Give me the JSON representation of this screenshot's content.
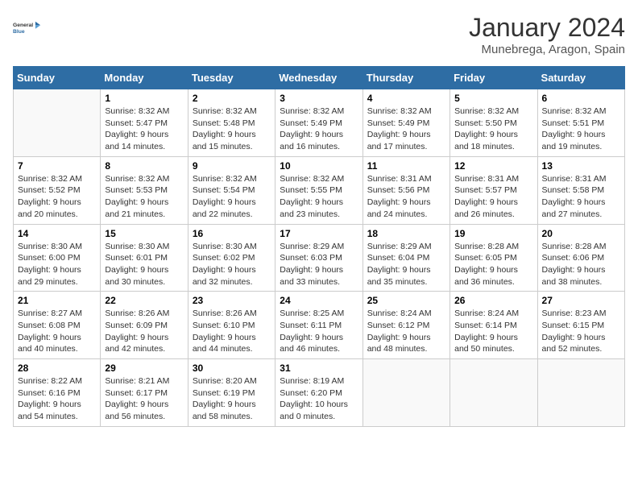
{
  "header": {
    "logo_line1": "General",
    "logo_line2": "Blue",
    "month_title": "January 2024",
    "location": "Munebrega, Aragon, Spain"
  },
  "days_of_week": [
    "Sunday",
    "Monday",
    "Tuesday",
    "Wednesday",
    "Thursday",
    "Friday",
    "Saturday"
  ],
  "weeks": [
    [
      {
        "day": "",
        "sunrise": "",
        "sunset": "",
        "daylight": ""
      },
      {
        "day": "1",
        "sunrise": "Sunrise: 8:32 AM",
        "sunset": "Sunset: 5:47 PM",
        "daylight": "Daylight: 9 hours and 14 minutes."
      },
      {
        "day": "2",
        "sunrise": "Sunrise: 8:32 AM",
        "sunset": "Sunset: 5:48 PM",
        "daylight": "Daylight: 9 hours and 15 minutes."
      },
      {
        "day": "3",
        "sunrise": "Sunrise: 8:32 AM",
        "sunset": "Sunset: 5:49 PM",
        "daylight": "Daylight: 9 hours and 16 minutes."
      },
      {
        "day": "4",
        "sunrise": "Sunrise: 8:32 AM",
        "sunset": "Sunset: 5:49 PM",
        "daylight": "Daylight: 9 hours and 17 minutes."
      },
      {
        "day": "5",
        "sunrise": "Sunrise: 8:32 AM",
        "sunset": "Sunset: 5:50 PM",
        "daylight": "Daylight: 9 hours and 18 minutes."
      },
      {
        "day": "6",
        "sunrise": "Sunrise: 8:32 AM",
        "sunset": "Sunset: 5:51 PM",
        "daylight": "Daylight: 9 hours and 19 minutes."
      }
    ],
    [
      {
        "day": "7",
        "sunrise": "Sunrise: 8:32 AM",
        "sunset": "Sunset: 5:52 PM",
        "daylight": "Daylight: 9 hours and 20 minutes."
      },
      {
        "day": "8",
        "sunrise": "Sunrise: 8:32 AM",
        "sunset": "Sunset: 5:53 PM",
        "daylight": "Daylight: 9 hours and 21 minutes."
      },
      {
        "day": "9",
        "sunrise": "Sunrise: 8:32 AM",
        "sunset": "Sunset: 5:54 PM",
        "daylight": "Daylight: 9 hours and 22 minutes."
      },
      {
        "day": "10",
        "sunrise": "Sunrise: 8:32 AM",
        "sunset": "Sunset: 5:55 PM",
        "daylight": "Daylight: 9 hours and 23 minutes."
      },
      {
        "day": "11",
        "sunrise": "Sunrise: 8:31 AM",
        "sunset": "Sunset: 5:56 PM",
        "daylight": "Daylight: 9 hours and 24 minutes."
      },
      {
        "day": "12",
        "sunrise": "Sunrise: 8:31 AM",
        "sunset": "Sunset: 5:57 PM",
        "daylight": "Daylight: 9 hours and 26 minutes."
      },
      {
        "day": "13",
        "sunrise": "Sunrise: 8:31 AM",
        "sunset": "Sunset: 5:58 PM",
        "daylight": "Daylight: 9 hours and 27 minutes."
      }
    ],
    [
      {
        "day": "14",
        "sunrise": "Sunrise: 8:30 AM",
        "sunset": "Sunset: 6:00 PM",
        "daylight": "Daylight: 9 hours and 29 minutes."
      },
      {
        "day": "15",
        "sunrise": "Sunrise: 8:30 AM",
        "sunset": "Sunset: 6:01 PM",
        "daylight": "Daylight: 9 hours and 30 minutes."
      },
      {
        "day": "16",
        "sunrise": "Sunrise: 8:30 AM",
        "sunset": "Sunset: 6:02 PM",
        "daylight": "Daylight: 9 hours and 32 minutes."
      },
      {
        "day": "17",
        "sunrise": "Sunrise: 8:29 AM",
        "sunset": "Sunset: 6:03 PM",
        "daylight": "Daylight: 9 hours and 33 minutes."
      },
      {
        "day": "18",
        "sunrise": "Sunrise: 8:29 AM",
        "sunset": "Sunset: 6:04 PM",
        "daylight": "Daylight: 9 hours and 35 minutes."
      },
      {
        "day": "19",
        "sunrise": "Sunrise: 8:28 AM",
        "sunset": "Sunset: 6:05 PM",
        "daylight": "Daylight: 9 hours and 36 minutes."
      },
      {
        "day": "20",
        "sunrise": "Sunrise: 8:28 AM",
        "sunset": "Sunset: 6:06 PM",
        "daylight": "Daylight: 9 hours and 38 minutes."
      }
    ],
    [
      {
        "day": "21",
        "sunrise": "Sunrise: 8:27 AM",
        "sunset": "Sunset: 6:08 PM",
        "daylight": "Daylight: 9 hours and 40 minutes."
      },
      {
        "day": "22",
        "sunrise": "Sunrise: 8:26 AM",
        "sunset": "Sunset: 6:09 PM",
        "daylight": "Daylight: 9 hours and 42 minutes."
      },
      {
        "day": "23",
        "sunrise": "Sunrise: 8:26 AM",
        "sunset": "Sunset: 6:10 PM",
        "daylight": "Daylight: 9 hours and 44 minutes."
      },
      {
        "day": "24",
        "sunrise": "Sunrise: 8:25 AM",
        "sunset": "Sunset: 6:11 PM",
        "daylight": "Daylight: 9 hours and 46 minutes."
      },
      {
        "day": "25",
        "sunrise": "Sunrise: 8:24 AM",
        "sunset": "Sunset: 6:12 PM",
        "daylight": "Daylight: 9 hours and 48 minutes."
      },
      {
        "day": "26",
        "sunrise": "Sunrise: 8:24 AM",
        "sunset": "Sunset: 6:14 PM",
        "daylight": "Daylight: 9 hours and 50 minutes."
      },
      {
        "day": "27",
        "sunrise": "Sunrise: 8:23 AM",
        "sunset": "Sunset: 6:15 PM",
        "daylight": "Daylight: 9 hours and 52 minutes."
      }
    ],
    [
      {
        "day": "28",
        "sunrise": "Sunrise: 8:22 AM",
        "sunset": "Sunset: 6:16 PM",
        "daylight": "Daylight: 9 hours and 54 minutes."
      },
      {
        "day": "29",
        "sunrise": "Sunrise: 8:21 AM",
        "sunset": "Sunset: 6:17 PM",
        "daylight": "Daylight: 9 hours and 56 minutes."
      },
      {
        "day": "30",
        "sunrise": "Sunrise: 8:20 AM",
        "sunset": "Sunset: 6:19 PM",
        "daylight": "Daylight: 9 hours and 58 minutes."
      },
      {
        "day": "31",
        "sunrise": "Sunrise: 8:19 AM",
        "sunset": "Sunset: 6:20 PM",
        "daylight": "Daylight: 10 hours and 0 minutes."
      },
      {
        "day": "",
        "sunrise": "",
        "sunset": "",
        "daylight": ""
      },
      {
        "day": "",
        "sunrise": "",
        "sunset": "",
        "daylight": ""
      },
      {
        "day": "",
        "sunrise": "",
        "sunset": "",
        "daylight": ""
      }
    ]
  ]
}
